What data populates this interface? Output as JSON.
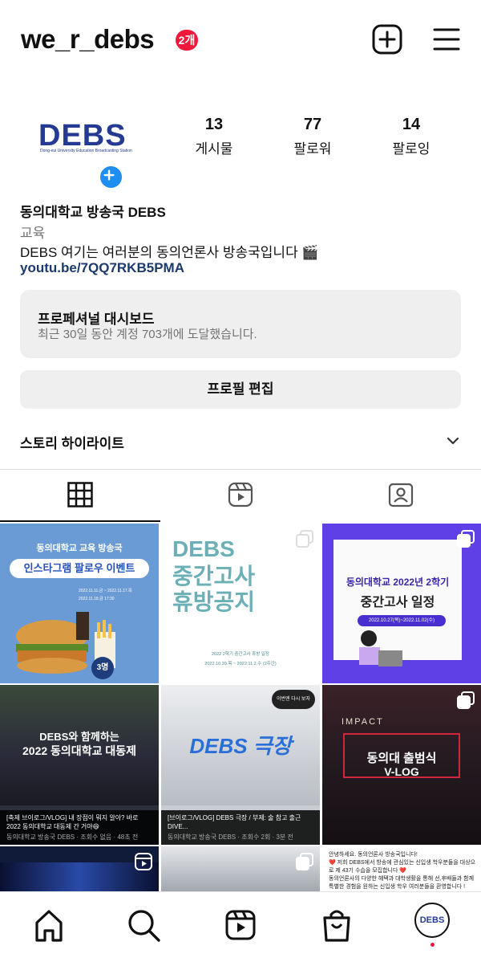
{
  "header": {
    "username": "we_r_debs",
    "notification_badge": "2개"
  },
  "profile": {
    "avatar_logo": "DEBS",
    "avatar_sub": "Dong-eui University Education Broadcasting Station",
    "stats": [
      {
        "value": "13",
        "label": "게시물"
      },
      {
        "value": "77",
        "label": "팔로워"
      },
      {
        "value": "14",
        "label": "팔로잉"
      }
    ],
    "name": "동의대학교 방송국 DEBS",
    "category": "교육",
    "bio": "DEBS 여기는 여러분의 동의언론사 방송국입니다 🎬",
    "link": "youtu.be/7QQ7RKB5PMA"
  },
  "dashboard": {
    "title": "프로페셔널 대시보드",
    "subtitle": "최근 30일 동안 계정 703개에 도달했습니다."
  },
  "edit_profile_label": "프로필 편집",
  "highlights_label": "스토리 하이라이트",
  "posts": [
    {
      "top": "동의대학교 교육 방송국",
      "title": "인스타그램 팔로우 이벤트",
      "badge": "3명",
      "d1": "2022.11.11.금 ~ 2022.11.17.목",
      "d2": "2022.11.18.금 17:30"
    },
    {
      "title1": "DEBS",
      "title2": "중간고사",
      "title3": "휴방공지",
      "note1": "2022 2학기 중간고사 휴방 일정",
      "note2": "2022.10.20.목 ~ 2022.11.2.수 (2주간)"
    },
    {
      "title": "동의대학교 2022년 2학기",
      "subtitle": "중간고사 일정",
      "date": "2022.10.27(목)~2022.11.02(수)"
    },
    {
      "title1": "DEBS와 함께하는",
      "title2": "2022 동의대학교 대동제",
      "caption": "[축제 브이로그/VLOG] 내 장점이 뭐지 알아? 바로 2022 동의대학교 대동제 간 거야😆",
      "meta": "동의대학교 방송국 DEBS · 조회수 없음 · 48초 전"
    },
    {
      "title": "DEBS 극장",
      "tag": "이번엔 다시 보자",
      "caption": "[브이로그/VLOG] DEBS 극장 / 부제: 술 참고 출근 DIVE...",
      "meta": "동의대학교 방송국 DEBS · 조회수 2회 · 3분 전"
    },
    {
      "banner": "IMPACT",
      "title1": "동의대 출범식",
      "title2": "V-LOG"
    },
    {
      "text": ""
    },
    {
      "text": ""
    },
    {
      "l1": "안녕하세요. 동의언론사 방송국입니다!",
      "l2": "❤️ 저희 DEBS에서 방송에 관심있는 신입생 학우분들을 대상으로 제 43기 수습을 모집합니다 ❤️",
      "l3": "동의언론사의 다양한 혜택과 대학생활을 통해 선,후배들과 함께 특별한 경험을 원하는 신입생 학우 여러분들을 환영합니다 !"
    }
  ],
  "bottom_nav": {
    "profile_label": "DEBS"
  },
  "colors": {
    "accent": "#1f8ef1",
    "badge": "#ef1a3b",
    "brand": "#253a92",
    "link": "#1c3a6c"
  }
}
